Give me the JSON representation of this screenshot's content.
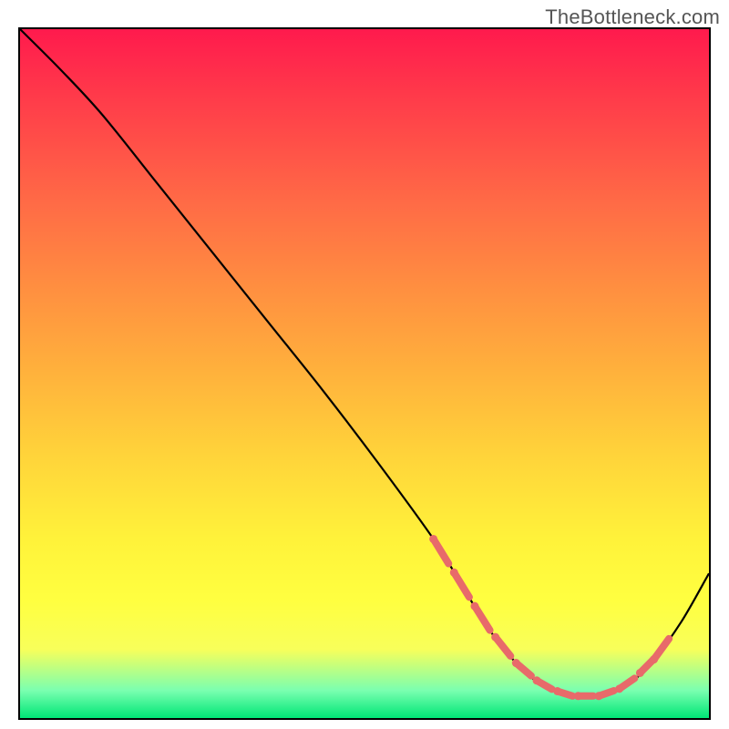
{
  "watermark": "TheBottleneck.com",
  "chart_data": {
    "type": "line",
    "title": "",
    "xlabel": "",
    "ylabel": "",
    "xlim": [
      0,
      100
    ],
    "ylim": [
      0,
      100
    ],
    "grid": false,
    "series": [
      {
        "name": "curve",
        "x": [
          0,
          6,
          12,
          20,
          28,
          36,
          44,
          52,
          60,
          64,
          68,
          72,
          76,
          80,
          84,
          88,
          92,
          96,
          100
        ],
        "y": [
          100,
          94,
          87.5,
          77.5,
          67.5,
          57.5,
          47.5,
          37,
          26,
          19.5,
          13,
          8,
          4.6,
          3.2,
          3.2,
          4.6,
          8.5,
          14,
          21
        ]
      }
    ],
    "markers": {
      "note": "coral dash/dot markers along the valley region of the curve",
      "points_along_curve_x": [
        60,
        63,
        66,
        69,
        72,
        75,
        78,
        81,
        84,
        87,
        90,
        92
      ]
    },
    "background": {
      "type": "vertical-gradient",
      "stops": [
        {
          "pos": 0.0,
          "color": "#ff1a4d"
        },
        {
          "pos": 0.5,
          "color": "#ffb23c"
        },
        {
          "pos": 0.83,
          "color": "#ffff40"
        },
        {
          "pos": 1.0,
          "color": "#00e676"
        }
      ]
    }
  }
}
